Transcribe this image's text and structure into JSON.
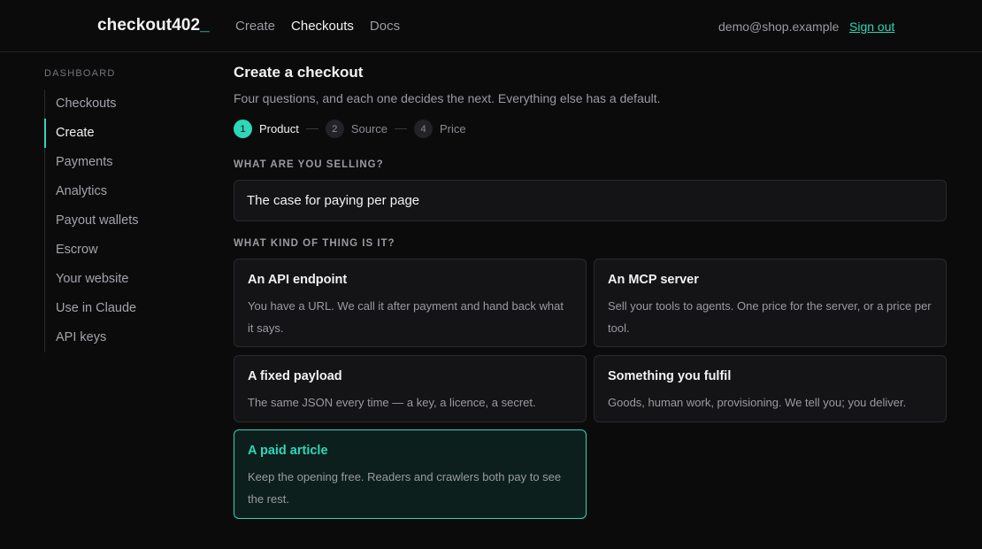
{
  "brand": {
    "name": "checkout402",
    "cursor": "_",
    "accent": "#2fd6b8"
  },
  "topnav": [
    {
      "label": "Create",
      "active": false
    },
    {
      "label": "Checkouts",
      "active": true
    },
    {
      "label": "Docs",
      "active": false
    }
  ],
  "user": {
    "email": "demo@shop.example",
    "signout_label": "Sign out"
  },
  "sidebar": {
    "heading": "DASHBOARD",
    "items": [
      {
        "label": "Checkouts"
      },
      {
        "label": "Create"
      },
      {
        "label": "Payments"
      },
      {
        "label": "Analytics"
      },
      {
        "label": "Payout wallets"
      },
      {
        "label": "Escrow"
      },
      {
        "label": "Your website"
      },
      {
        "label": "Use in Claude"
      },
      {
        "label": "API keys"
      }
    ],
    "active_index": 1
  },
  "main": {
    "title": "Create a checkout",
    "subtitle": "Four questions, and each one decides the next. Everything else has a default.",
    "steps": [
      {
        "num": "1",
        "label": "Product"
      },
      {
        "num": "2",
        "label": "Source"
      },
      {
        "num": "4",
        "label": "Price"
      }
    ],
    "current_step": 1,
    "selling_label": "WHAT ARE YOU SELLING?",
    "selling_value": "The case for paying per page",
    "kind_label": "WHAT KIND OF THING IS IT?",
    "kinds": [
      {
        "title": "An API endpoint",
        "desc": "You have a URL. We call it after payment and hand back what it says."
      },
      {
        "title": "An MCP server",
        "desc": "Sell your tools to agents. One price for the server, or a price per tool."
      },
      {
        "title": "A fixed payload",
        "desc": "The same JSON every time — a key, a licence, a secret."
      },
      {
        "title": "Something you fulfil",
        "desc": "Goods, human work, provisioning. We tell you; you deliver."
      },
      {
        "title": "A paid article",
        "desc": "Keep the opening free. Readers and crawlers both pay to see the rest."
      }
    ],
    "selected_kind": "A paid article"
  }
}
